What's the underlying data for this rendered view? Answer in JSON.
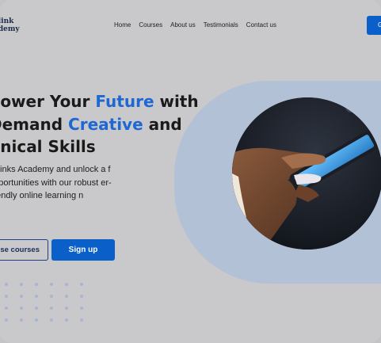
{
  "brand": {
    "logo_line1": "elink",
    "logo_line2": "ademy"
  },
  "nav": {
    "items": [
      {
        "label": "Home"
      },
      {
        "label": "Courses"
      },
      {
        "label": "About us"
      },
      {
        "label": "Testimonials"
      },
      {
        "label": "Contact us"
      }
    ]
  },
  "header": {
    "cta_label": "G"
  },
  "hero": {
    "headline_1a": "power Your ",
    "headline_1b": "Future",
    "headline_1c": " with",
    "headline_2a": "Demand ",
    "headline_2b": "Creative",
    "headline_2c": " and",
    "headline_3": "nnical Skills",
    "subtext": "selinks Academy and unlock a f opportunities with our robust er-friendly online learning n",
    "browse_label": "se courses",
    "signup_label": "Sign up"
  },
  "colors": {
    "accent": "#0a5fc9",
    "headline_highlight": "#1f67d3",
    "shape": "#b3c1d6"
  }
}
